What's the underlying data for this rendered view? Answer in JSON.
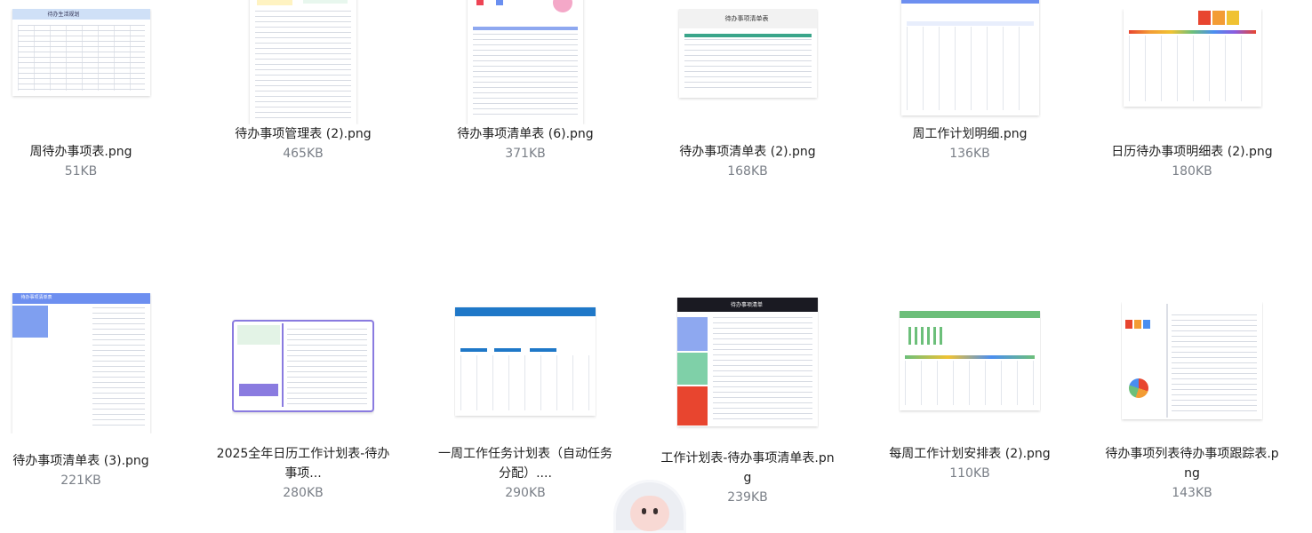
{
  "files": [
    {
      "name": "周待办事项表.png",
      "size": "51KB"
    },
    {
      "name": "待办事项管理表 (2).png",
      "size": "465KB"
    },
    {
      "name": "待办事项清单表 (6).png",
      "size": "371KB"
    },
    {
      "name": "待办事项清单表 (2).png",
      "size": "168KB"
    },
    {
      "name": "周工作计划明细.png",
      "size": "136KB"
    },
    {
      "name": "日历待办事项明细表 (2).png",
      "size": "180KB"
    },
    {
      "name": "待办事项清单表 (3).png",
      "size": "221KB"
    },
    {
      "name": "2025全年日历工作计划表-待办事项...",
      "size": "280KB"
    },
    {
      "name": "一周工作任务计划表（自动任务分配）....",
      "size": "290KB"
    },
    {
      "name": "工作计划表-待办事项清单表.png",
      "size": "239KB"
    },
    {
      "name": "每周工作计划安排表 (2).png",
      "size": "110KB"
    },
    {
      "name": "待办事项列表待办事项跟踪表.png",
      "size": "143KB"
    }
  ],
  "thumb_text": {
    "t1": "待办生活规划",
    "t4": "待办事项清单表",
    "t7": "待办事项清单表",
    "t10": "待办事项清单"
  },
  "colors": {
    "accent_blue": "#6d8ff0",
    "accent_purple": "#8a7be0",
    "accent_green": "#6cbf7a",
    "accent_teal": "#3aa58a"
  },
  "assistant": {
    "icon": "assistant-mascot-icon"
  }
}
